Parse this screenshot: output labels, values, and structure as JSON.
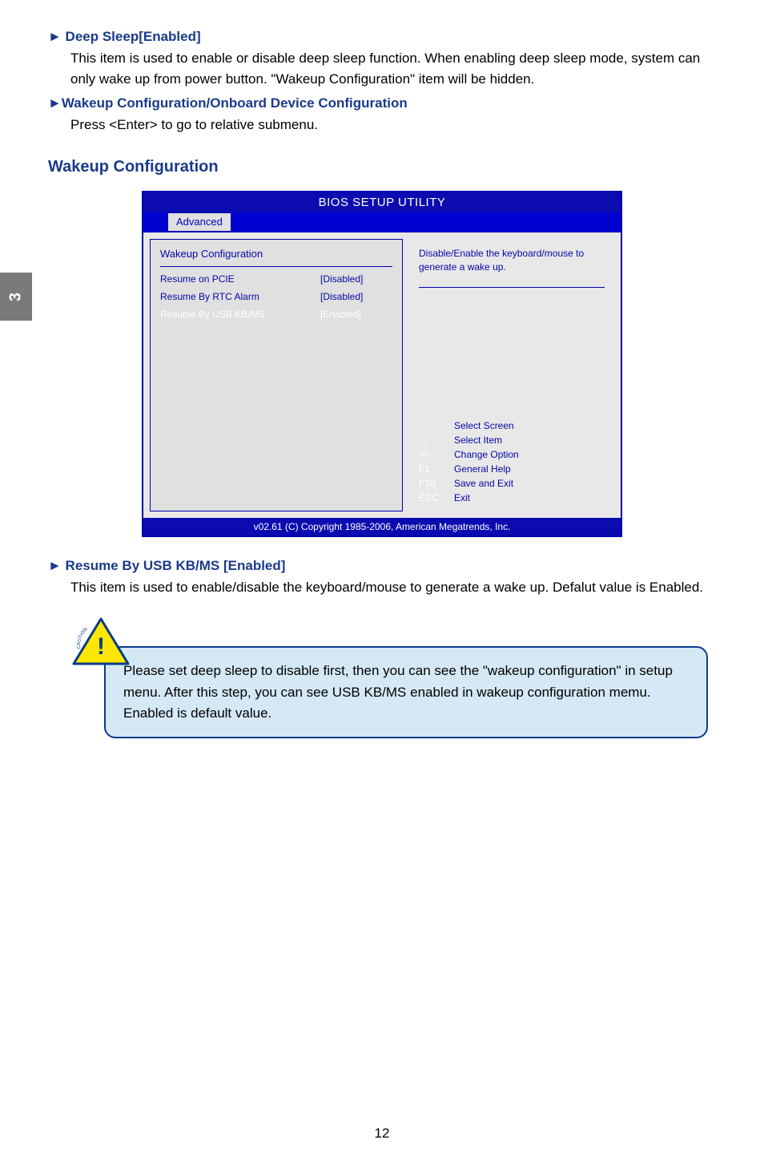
{
  "sideTab": "3",
  "items": [
    {
      "heading": "► Deep Sleep[Enabled]",
      "body": "This item is used to enable or disable deep sleep function. When enabling deep sleep mode, system can only wake up from power button. \"Wakeup Configuration\" item will be hidden."
    },
    {
      "heading": "►Wakeup Configuration/Onboard Device Configuration",
      "body": "Press <Enter> to go to relative submenu."
    }
  ],
  "sectionTitle": "Wakeup Configuration",
  "bios": {
    "title": "BIOS SETUP UTILITY",
    "tab": "Advanced",
    "panelTitle": "Wakeup  Configuration",
    "rows": [
      {
        "label": "Resume on PCIE",
        "value": "[Disabled]",
        "selected": false
      },
      {
        "label": "Resume By RTC Alarm",
        "value": "[Disabled]",
        "selected": false
      },
      {
        "label": "Resume By USB KB/MS",
        "value": "[Enabled]",
        "selected": true
      }
    ],
    "help": "Disable/Enable the keyboard/mouse to generate a wake up.",
    "keys": [
      {
        "k": "←",
        "d": "Select Screen"
      },
      {
        "k": "↑↓",
        "d": "Select Item"
      },
      {
        "k": "+/-",
        "d": "Change Option"
      },
      {
        "k": "F1",
        "d": "General Help"
      },
      {
        "k": "F10",
        "d": "Save and Exit"
      },
      {
        "k": "ESC",
        "d": "Exit"
      }
    ],
    "footer": "v02.61 (C) Copyright 1985-2006, American Megatrends, Inc."
  },
  "resume": {
    "heading": "► Resume By USB KB/MS [Enabled]",
    "body": "This item is used to enable/disable the keyboard/mouse to generate a wake up. Defalut value is Enabled."
  },
  "caution": {
    "label": "CAUTION",
    "mark": "!",
    "text": "Please set deep sleep to disable first, then you can see the \"wakeup configuration\" in setup menu. After this step, you can see USB KB/MS enabled in wakeup configuration memu. Enabled is default value."
  },
  "pageNum": "12"
}
